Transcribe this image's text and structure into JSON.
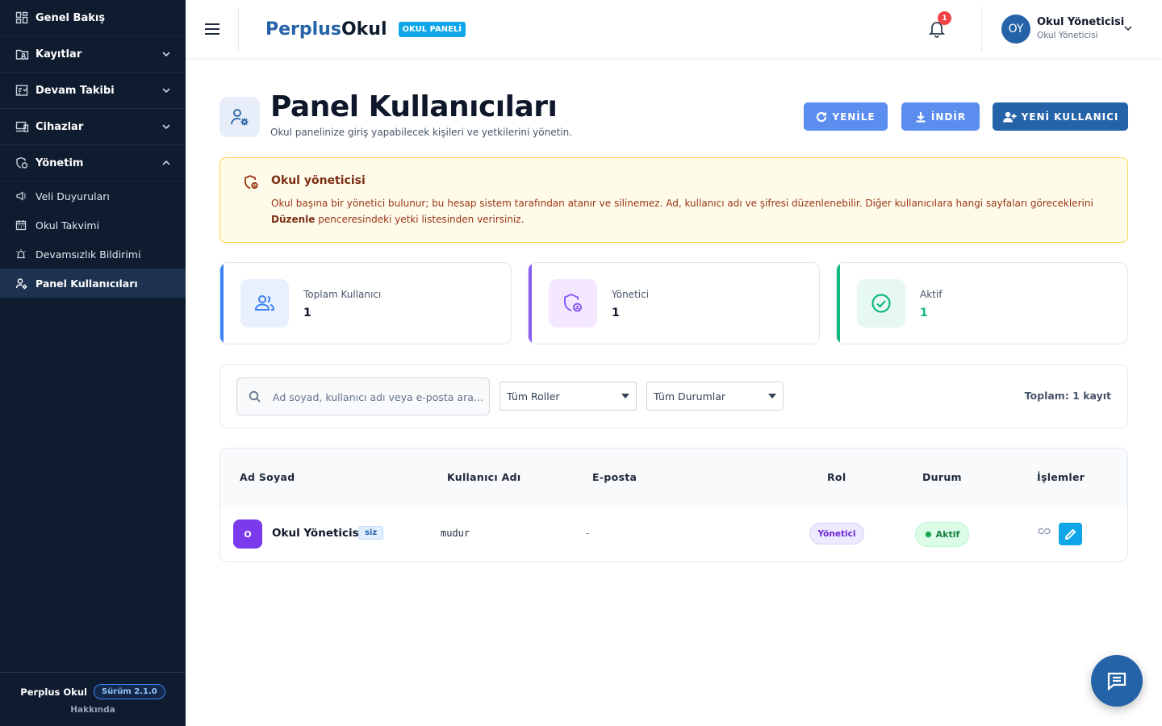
{
  "sidebar": {
    "items": [
      {
        "label": "Genel Bakış",
        "icon": "dashboard-icon"
      },
      {
        "label": "Kayıtlar",
        "icon": "folder-user-icon"
      },
      {
        "label": "Devam Takibi",
        "icon": "attendance-icon"
      },
      {
        "label": "Cihazlar",
        "icon": "devices-icon"
      },
      {
        "label": "Yönetim",
        "icon": "shield-admin-icon"
      }
    ],
    "sub_items": [
      {
        "label": "Veli Duyuruları",
        "icon": "megaphone-icon"
      },
      {
        "label": "Okul Takvimi",
        "icon": "calendar-icon"
      },
      {
        "label": "Devamsızlık Bildirimi",
        "icon": "alarm-icon"
      },
      {
        "label": "Panel Kullanıcıları",
        "icon": "users-gear-icon",
        "active": true
      }
    ],
    "footer": {
      "app_name": "Perplus Okul",
      "version": "Sürüm 2.1.0",
      "about": "Hakkında"
    }
  },
  "header": {
    "brand_part1": "Perplus",
    "brand_part2": "Okul",
    "brand_badge": "OKUL PANELİ",
    "notification_count": "1",
    "avatar_initials": "OY",
    "user_name": "Okul Yöneticisi",
    "user_role": "Okul Yöneticisi"
  },
  "page": {
    "title": "Panel Kullanıcıları",
    "subtitle": "Okul panelinize giriş yapabilecek kişileri ve yetkilerini yönetin.",
    "buttons": {
      "refresh": "YENİLE",
      "download": "İNDİR",
      "new_user": "YENİ KULLANICI"
    }
  },
  "alert": {
    "title": "Okul yöneticisi",
    "text_before": "Okul başına bir yönetici bulunur; bu hesap sistem tarafından atanır ve silinemez. Ad, kullanıcı adı ve şifresi düzenlenebilir. Diğer kullanıcılara hangi sayfaları göreceklerini ",
    "text_bold": "Düzenle",
    "text_after": " penceresindeki yetki listesinden verirsiniz."
  },
  "stats": [
    {
      "label": "Toplam Kullanıcı",
      "value": "1",
      "color": "#3b82f6"
    },
    {
      "label": "Yönetici",
      "value": "1",
      "color": "#8b5cf6"
    },
    {
      "label": "Aktif",
      "value": "1",
      "color": "#10b981"
    }
  ],
  "filters": {
    "search_placeholder": "Ad soyad, kullanıcı adı veya e-posta ara...",
    "role_select": "Tüm Roller",
    "status_select": "Tüm Durumlar",
    "total": "Toplam: 1 kayıt"
  },
  "table": {
    "columns": [
      "Ad Soyad",
      "Kullanıcı Adı",
      "E-posta",
      "Rol",
      "Durum",
      "İşlemler"
    ],
    "rows": [
      {
        "avatar": "O",
        "name": "Okul Yöneticisi",
        "you_badge": "siz",
        "username": "mudur",
        "email": "-",
        "role": "Yönetici",
        "status": "Aktif"
      }
    ]
  },
  "colors": {
    "sidebar_bg": "#0f1b2e",
    "primary": "#2563a8",
    "accent": "#5b8def"
  }
}
